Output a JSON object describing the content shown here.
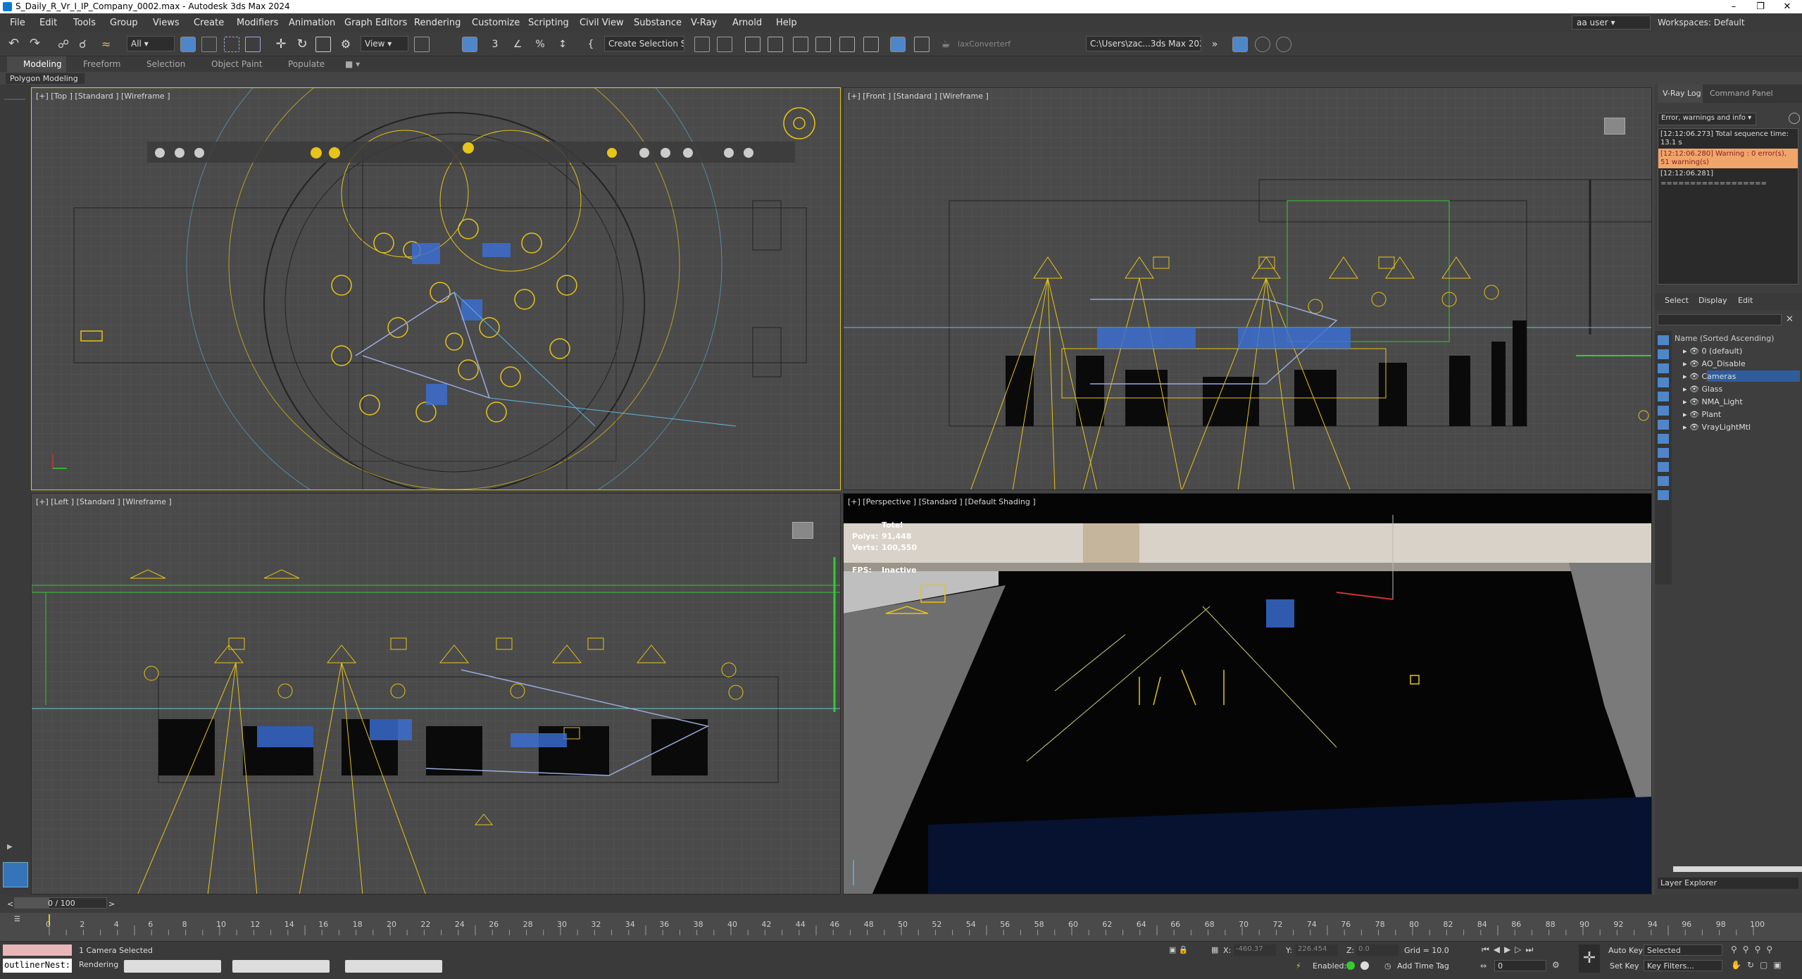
{
  "window": {
    "title": "S_Daily_R_Vr_I_IP_Company_0002.max - Autodesk 3ds Max 2024"
  },
  "menu": [
    "File",
    "Edit",
    "Tools",
    "Group",
    "Views",
    "Create",
    "Modifiers",
    "Animation",
    "Graph Editors",
    "Rendering",
    "Customize",
    "Scripting",
    "Civil View",
    "Substance",
    "V-Ray",
    "Arnold",
    "Help"
  ],
  "user": "aa user",
  "workspace": "Workspaces: Default",
  "toolbar": {
    "filter": "All",
    "view": "View",
    "selection_set": "Create Selection Se",
    "plugin": "laxConverterf",
    "path": "C:\\Users\\zac...3ds Max 2024"
  },
  "ribbon": {
    "tabs": [
      "Modeling",
      "Freeform",
      "Selection",
      "Object Paint",
      "Populate"
    ],
    "sub": "Polygon Modeling"
  },
  "viewports": {
    "top": "[+] [Top ] [Standard ] [Wireframe ]",
    "front": "[+] [Front ] [Standard ] [Wireframe ]",
    "left": "[+] [Left ] [Standard ] [Wireframe ]",
    "persp": "[+] [Perspective ] [Standard ] [Default Shading ]"
  },
  "stats": {
    "total": "Total",
    "polys_label": "Polys:",
    "polys": "91,448",
    "verts_label": "Verts:",
    "verts": "100,550",
    "fps_label": "FPS:",
    "fps": "Inactive"
  },
  "vray_log": {
    "tab": "V-Ray Log",
    "tab2": "Command Panel",
    "filter": "Error, warnings and info",
    "lines": [
      "[12:12:06.273] Total sequence time: 13.1 s",
      "[12:12:06.280] Warning : 0 error(s), 51 warning(s)",
      "[12:12:06.281]",
      "=================="
    ]
  },
  "scene_explorer": {
    "tabs": [
      "Select",
      "Display",
      "Edit"
    ],
    "column": "Name (Sorted Ascending)",
    "layers": [
      "0 (default)",
      "AO_Disable",
      "Cameras",
      "Glass",
      "NMA_Light",
      "Plant",
      "VrayLightMtl"
    ],
    "footer": "Layer Explorer"
  },
  "timeline": {
    "frame": "0 / 100",
    "ticks": [
      "0",
      "2",
      "4",
      "6",
      "8",
      "10",
      "12",
      "14",
      "16",
      "18",
      "20",
      "22",
      "24",
      "26",
      "28",
      "30",
      "32",
      "34",
      "36",
      "38",
      "40",
      "42",
      "44",
      "46",
      "48",
      "50",
      "52",
      "54",
      "56",
      "58",
      "60",
      "62",
      "64",
      "66",
      "68",
      "70",
      "72",
      "74",
      "76",
      "78",
      "80",
      "82",
      "84",
      "86",
      "88",
      "90",
      "92",
      "94",
      "96",
      "98",
      "100"
    ]
  },
  "status": {
    "selected": "1 Camera Selected",
    "rendering": "Rendering",
    "listener": "outlinerNest:",
    "x_label": "X:",
    "x": "-460.37",
    "y_label": "Y:",
    "y": "226.454",
    "z_label": "Z:",
    "z": "0.0",
    "grid": "Grid = 10.0",
    "enabled": "Enabled:",
    "add_time_tag": "Add Time Tag",
    "auto_key": "Auto Key",
    "set_key": "Set Key",
    "selected_dd": "Selected",
    "key_filters": "Key Filters...",
    "frame_val": "0"
  },
  "colors": {
    "wire_yellow": "#e6c419",
    "wire_blue": "#3a6fd8",
    "wire_cyan": "#5fb6d9",
    "selected_row": "#2f5d9c",
    "warning": "#f0a56a"
  }
}
